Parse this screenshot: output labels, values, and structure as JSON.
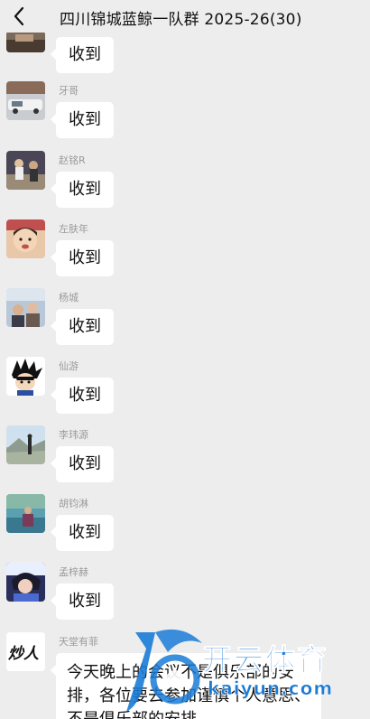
{
  "header": {
    "title": "四川锦城蓝鲸一队群 2025-26(30)"
  },
  "messages": [
    {
      "sender": "",
      "text": "收到"
    },
    {
      "sender": "牙哥",
      "text": "收到"
    },
    {
      "sender": "赵铭R",
      "text": "收到"
    },
    {
      "sender": "左肤年",
      "text": "收到"
    },
    {
      "sender": "杨城",
      "text": "收到"
    },
    {
      "sender": "仙游",
      "text": "收到"
    },
    {
      "sender": "李玮源",
      "text": "收到"
    },
    {
      "sender": "胡钧淋",
      "text": "收到"
    },
    {
      "sender": "孟梓赫",
      "text": "收到"
    },
    {
      "sender": "天堂有菲",
      "text": "今天晚上的会议不是俱乐部的安排，各位要去参加谨慎个人意思、不是俱乐部的安排。"
    }
  ],
  "avatars": {
    "last_avatar_text": "炒人"
  },
  "watermark": {
    "brand": "开云体育",
    "site": "kaiyun.com",
    "color": "#1a7bd6"
  }
}
